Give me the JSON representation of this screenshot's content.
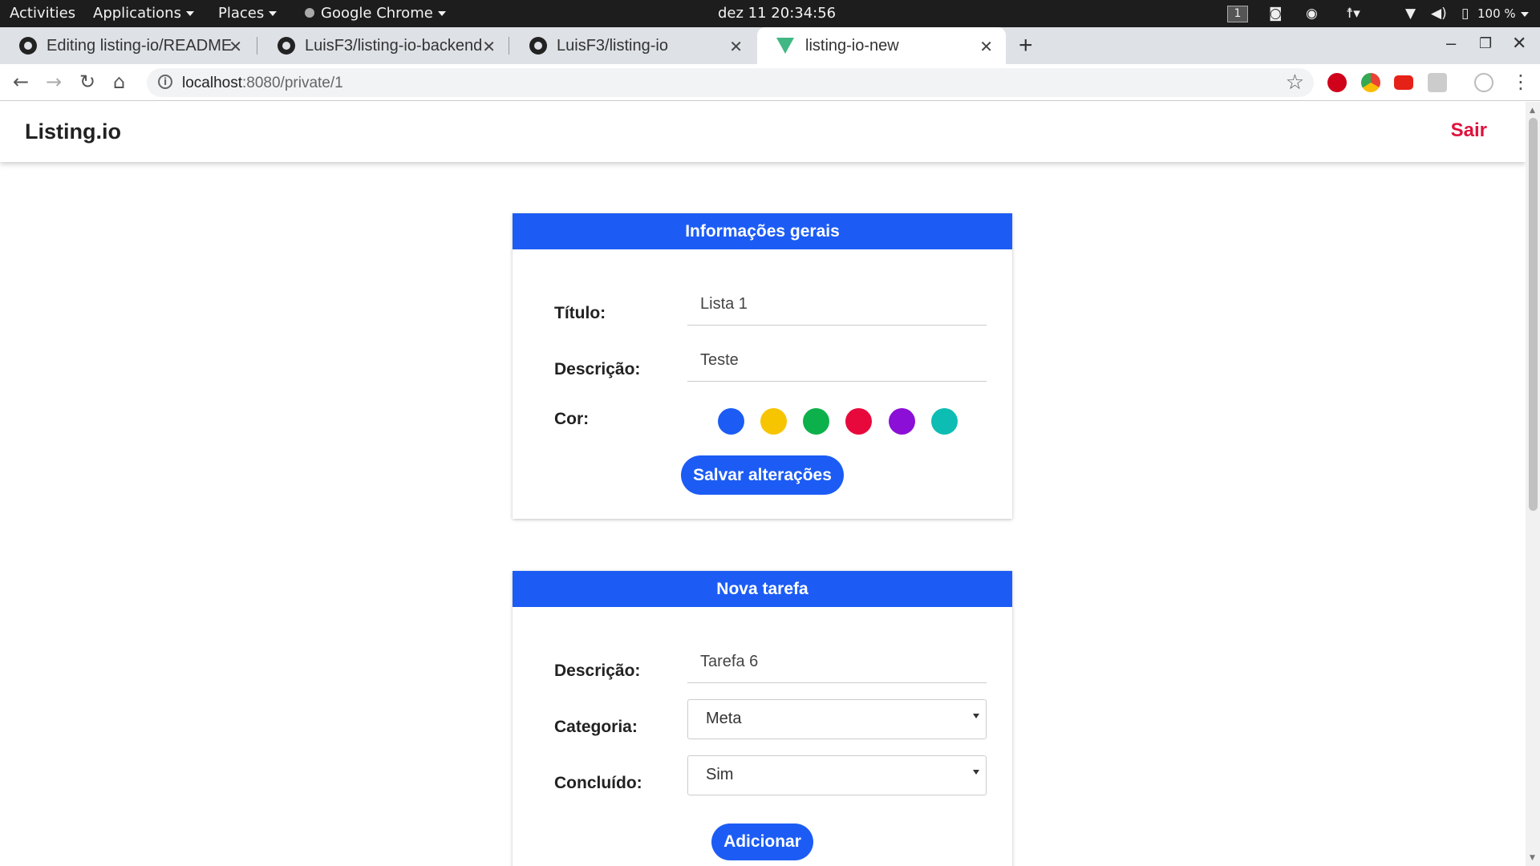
{
  "system_bar": {
    "activities": "Activities",
    "applications": "Applications",
    "places": "Places",
    "app_name": "Google Chrome",
    "datetime": "dez 11  20:34:56",
    "workspace": "1",
    "battery": "100 %"
  },
  "browser": {
    "tabs": [
      {
        "title": "Editing listing-io/README",
        "icon": "github-icon"
      },
      {
        "title": "LuisF3/listing-io-backend",
        "icon": "github-icon"
      },
      {
        "title": "LuisF3/listing-io",
        "icon": "github-icon"
      },
      {
        "title": "listing-io-new",
        "icon": "vue-icon",
        "active": true
      }
    ],
    "url_host": "localhost",
    "url_rest": ":8080/private/1",
    "extensions": [
      "adblock-icon",
      "chrome-extension-icon",
      "youtube-icon",
      "m-extension-icon",
      "profile-icon"
    ]
  },
  "app": {
    "brand": "Listing.io",
    "logout": "Sair"
  },
  "general_card": {
    "header": "Informações gerais",
    "title_label": "Título:",
    "title_value": "Lista 1",
    "desc_label": "Descrição:",
    "desc_value": "Teste",
    "color_label": "Cor:",
    "colors": [
      "#1c5cf5",
      "#f7c400",
      "#0db14b",
      "#e8093c",
      "#8b0fd6",
      "#0dbdb3"
    ],
    "save_button": "Salvar alterações"
  },
  "task_card": {
    "header": "Nova tarefa",
    "desc_label": "Descrição:",
    "desc_value": "Tarefa 6",
    "category_label": "Categoria:",
    "category_value": "Meta",
    "done_label": "Concluído:",
    "done_value": "Sim",
    "add_button": "Adicionar"
  }
}
